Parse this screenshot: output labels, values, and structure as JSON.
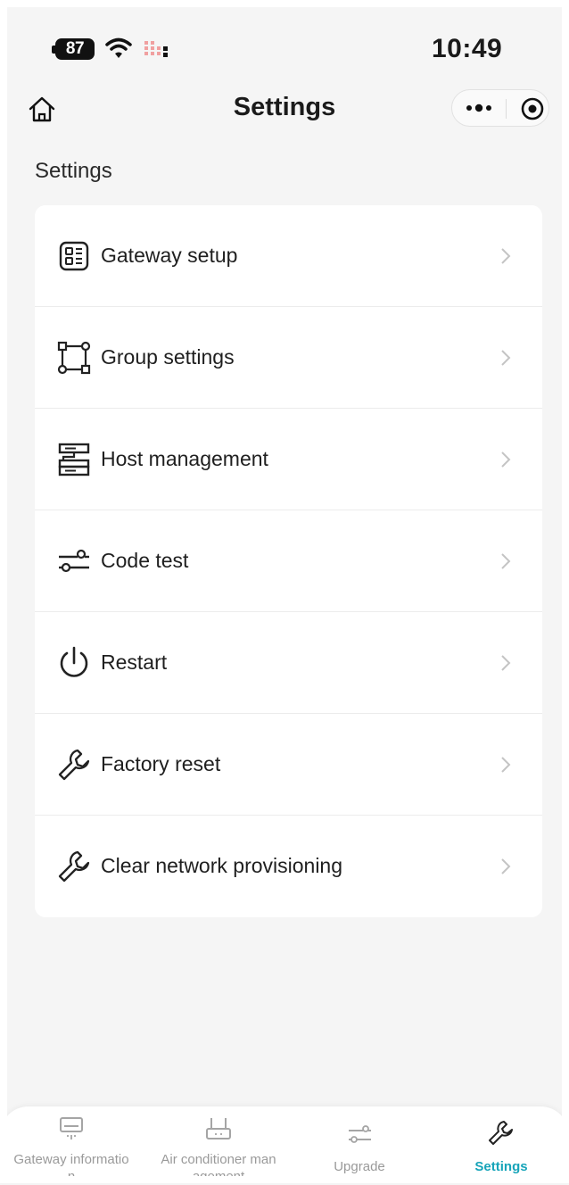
{
  "status_bar": {
    "battery": "87",
    "time": "10:49"
  },
  "nav": {
    "title": "Settings",
    "home_icon": "home-icon",
    "more_icon": "more-dots-icon",
    "close_icon": "target-circle-icon"
  },
  "section": {
    "title": "Settings"
  },
  "menu": {
    "items": [
      {
        "label": "Gateway setup",
        "icon": "gateway-list-icon"
      },
      {
        "label": "Group settings",
        "icon": "group-nodes-icon"
      },
      {
        "label": "Host management",
        "icon": "server-stack-icon"
      },
      {
        "label": "Code test",
        "icon": "sliders-icon"
      },
      {
        "label": "Restart",
        "icon": "power-icon"
      },
      {
        "label": "Factory reset",
        "icon": "wrench-icon"
      },
      {
        "label": "Clear network provisioning",
        "icon": "wrench-icon"
      }
    ]
  },
  "tabbar": {
    "tabs": [
      {
        "label_line1": "Gateway informatio",
        "label_line2": "n",
        "icon": "air-conditioner-icon",
        "active": false
      },
      {
        "label_line1": "Air conditioner man",
        "label_line2": "agement",
        "icon": "ac-unit-icon",
        "active": false
      },
      {
        "label": "Upgrade",
        "icon": "sliders-icon",
        "active": false
      },
      {
        "label": "Settings",
        "icon": "wrench-icon",
        "active": true
      }
    ]
  },
  "colors": {
    "accent": "#17a4b9",
    "background": "#f5f5f5",
    "card": "#ffffff",
    "inactive_tab": "#9a9a9a"
  }
}
